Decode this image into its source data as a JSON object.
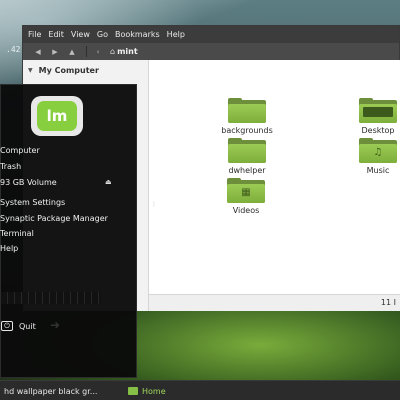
{
  "desktop": {
    "top_left_text": ".42"
  },
  "file_manager": {
    "menubar": [
      "File",
      "Edit",
      "View",
      "Go",
      "Bookmarks",
      "Help"
    ],
    "location": "mint",
    "sidebar_header": "My Computer",
    "items": [
      {
        "label": "backgrounds",
        "icon": "folder-icon"
      },
      {
        "label": "Desktop",
        "icon": "desktop-folder-icon"
      },
      {
        "label": "dwhelper",
        "icon": "folder-icon"
      },
      {
        "label": "Music",
        "icon": "music-folder-icon"
      },
      {
        "label": "Videos",
        "icon": "video-folder-icon"
      }
    ],
    "status_text": "11 I"
  },
  "menu": {
    "items": [
      {
        "label": "Computer"
      },
      {
        "label": "Trash"
      },
      {
        "label": "93 GB Volume"
      },
      {
        "label": "System Settings"
      },
      {
        "label": "Synaptic Package Manager"
      },
      {
        "label": "Terminal"
      },
      {
        "label": "Help"
      }
    ],
    "quit_label": "Quit"
  },
  "taskbar": {
    "tasks": [
      {
        "label": "hd wallpaper black gr..."
      },
      {
        "label": "Home"
      }
    ]
  }
}
